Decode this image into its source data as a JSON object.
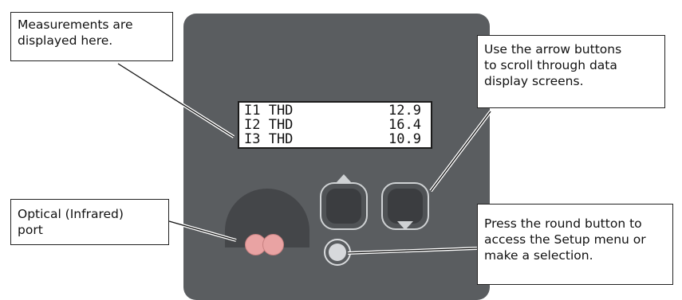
{
  "display": {
    "rows": [
      {
        "name": "I1 THD",
        "value": "12.9"
      },
      {
        "name": "I2 THD",
        "value": "16.4"
      },
      {
        "name": "I3 THD",
        "value": "10.9"
      }
    ]
  },
  "callouts": {
    "display_note": "Measurements are\ndisplayed here.",
    "arrows_note": "Use the arrow buttons\nto scroll through data\ndisplay screens.",
    "port_note": "Optical (Infrared)\nport",
    "round_note": "Press the round button to\naccess the Setup menu or\nmake a selection."
  },
  "colors": {
    "panel": "#5a5d60",
    "lens": "#e9a3a3",
    "button_face": "#3b3d40"
  },
  "icons": {
    "up": "up-arrow-icon",
    "down": "down-arrow-icon"
  }
}
